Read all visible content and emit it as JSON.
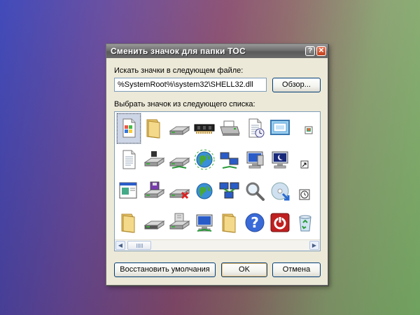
{
  "dialog": {
    "title": "Сменить значок для папки TOC",
    "help_label": "?",
    "close_label": "✕",
    "file_label": "Искать значки в следующем файле:",
    "file_path": "%SystemRoot%\\system32\\SHELL32.dll",
    "browse_label": "Обзор...",
    "list_label": "Выбрать значок из следующего списка:",
    "restore_label": "Восстановить умолчания",
    "ok_label": "OK",
    "cancel_label": "Отмена"
  },
  "icons": [
    "windows-document-icon",
    "folder-icon",
    "floppy-drive-icon",
    "memory-chip-icon",
    "printer-icon",
    "scheduled-document-icon",
    "display-settings-icon",
    "network-small-icon",
    "text-document-icon",
    "removable-drive-icon",
    "network-drive-icon",
    "globe-network-icon",
    "network-computers-icon",
    "computer-workstation-icon",
    "night-display-icon",
    "shortcut-arrow-icon",
    "application-window-icon",
    "floppy-disk-drive-icon",
    "disconnected-drive-icon",
    "internet-globe-icon",
    "network-places-icon",
    "search-magnifier-icon",
    "cd-restore-icon",
    "clock-icon",
    "folder-icon",
    "hard-drive-icon",
    "server-drive-icon",
    "monitor-network-icon",
    "folder-icon",
    "help-question-icon",
    "power-shutdown-icon",
    "recycle-bin-icon"
  ],
  "selected_index": 0,
  "colors": {
    "dialog_face": "#ece9d8",
    "titlebar": "#6e6e6e",
    "input_border": "#7f9db9",
    "selection": "#cdd6e6"
  }
}
